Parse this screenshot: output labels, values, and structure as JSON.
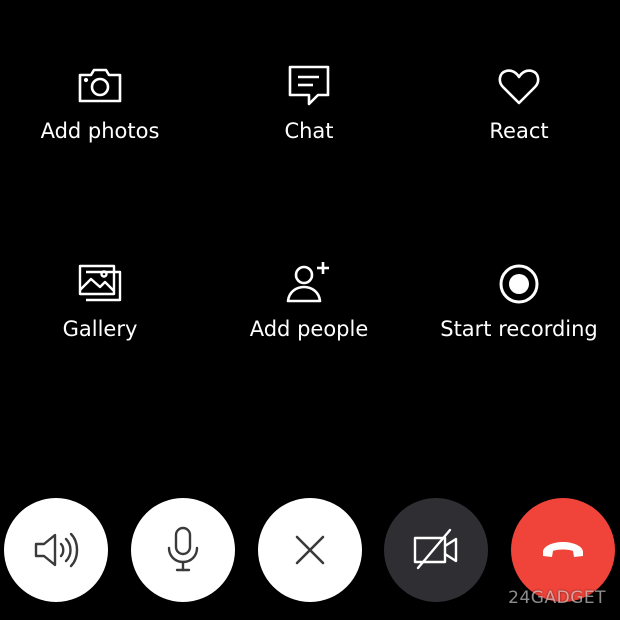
{
  "actions_row1": [
    {
      "label": "Add photos",
      "icon": "camera-icon"
    },
    {
      "label": "Chat",
      "icon": "chat-icon"
    },
    {
      "label": "React",
      "icon": "heart-icon"
    }
  ],
  "actions_row2": [
    {
      "label": "Gallery",
      "icon": "gallery-icon"
    },
    {
      "label": "Add people",
      "icon": "add-person-icon"
    },
    {
      "label": "Start recording",
      "icon": "record-icon"
    }
  ],
  "call_controls": [
    {
      "name": "speaker",
      "icon": "speaker-icon",
      "color": "#ffffff"
    },
    {
      "name": "microphone",
      "icon": "microphone-icon",
      "color": "#ffffff"
    },
    {
      "name": "close",
      "icon": "close-icon",
      "color": "#ffffff"
    },
    {
      "name": "video-off",
      "icon": "video-off-icon",
      "color": "#2f2f33"
    },
    {
      "name": "end-call",
      "icon": "hang-up-icon",
      "color": "#f0443a"
    }
  ],
  "watermark": "24GADGET"
}
